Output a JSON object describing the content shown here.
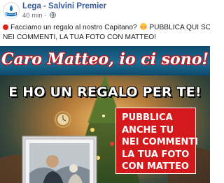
{
  "post": {
    "page_name": "Lega - Salvini Premier",
    "time": "40 min",
    "separator": "·",
    "text_line1": "Facciamo un regalo al nostro Capitano?",
    "text_line1_tail": "PUBBLICA QUI SOTTO,",
    "text_line2": "NEI COMMENTI, LA TUA FOTO CON MATTEO!"
  },
  "image": {
    "title": "Caro Matteo, io ci sono!",
    "subtitle": "E HO UN REGALO PER TE!",
    "cta_lines": [
      "PUBBLICA",
      "ANCHE TU",
      "NEI COMMENTI",
      "LA TUA FOTO",
      "CON MATTEO"
    ]
  },
  "colors": {
    "page_name": "#365899",
    "banner": "#1c6c93",
    "cta_background": "#d3191c"
  },
  "icons": {
    "avatar": "lega-logo",
    "privacy": "globe-icon",
    "emoji_bullet": "red-circle",
    "emoji_face": "blushing-face"
  }
}
